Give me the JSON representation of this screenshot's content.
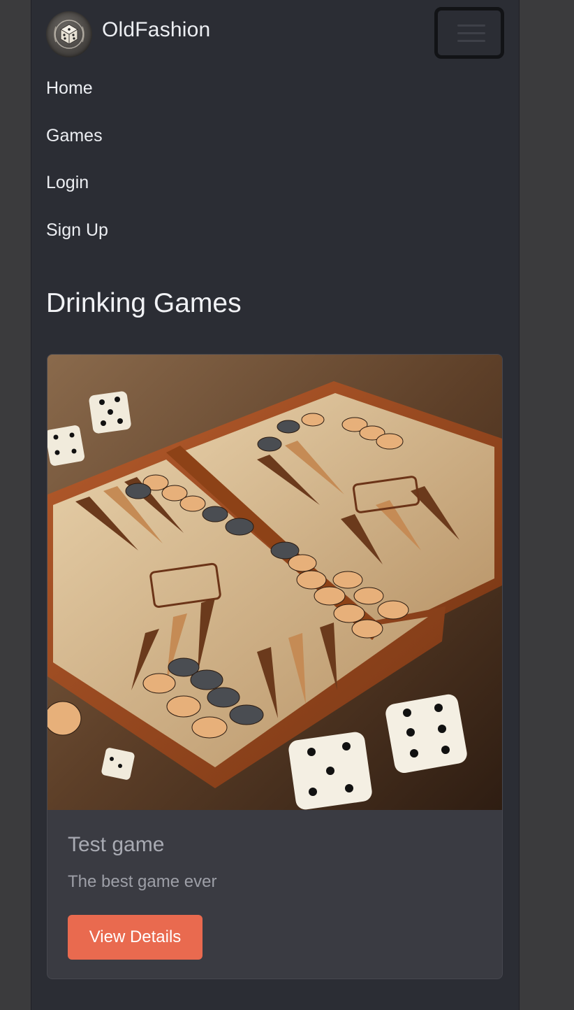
{
  "navbar": {
    "brand_name": "OldFashion",
    "logo_icon": "dice-logo-icon",
    "toggler_icon": "hamburger-menu-icon"
  },
  "menu": {
    "items": [
      {
        "label": "Home"
      },
      {
        "label": "Games"
      },
      {
        "label": "Login"
      },
      {
        "label": "Sign Up"
      }
    ]
  },
  "main": {
    "section_title": "Drinking Games",
    "cards": [
      {
        "image_icon": "backgammon-board-image",
        "title": "Test game",
        "description": "The best game ever",
        "button_label": "View Details"
      }
    ]
  },
  "colors": {
    "page_background": "#2b2d34",
    "card_background": "#3a3b42",
    "accent_button": "#e96a4f",
    "text_primary": "#eceef2"
  }
}
